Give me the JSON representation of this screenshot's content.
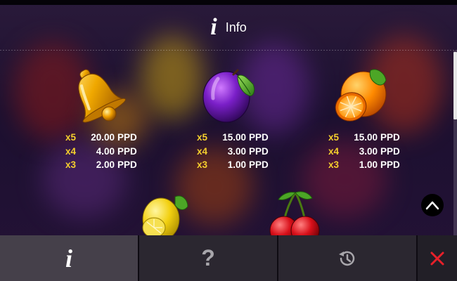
{
  "header": {
    "icon": "info-icon",
    "glyph": "i",
    "title": "Info"
  },
  "paytable": [
    {
      "symbol": "bell",
      "icon": "bell-icon",
      "pays": [
        {
          "mult": "x5",
          "value": "20.00",
          "currency": "PPD"
        },
        {
          "mult": "x4",
          "value": "4.00",
          "currency": "PPD"
        },
        {
          "mult": "x3",
          "value": "2.00",
          "currency": "PPD"
        }
      ]
    },
    {
      "symbol": "plum",
      "icon": "plum-icon",
      "pays": [
        {
          "mult": "x5",
          "value": "15.00",
          "currency": "PPD"
        },
        {
          "mult": "x4",
          "value": "3.00",
          "currency": "PPD"
        },
        {
          "mult": "x3",
          "value": "1.00",
          "currency": "PPD"
        }
      ]
    },
    {
      "symbol": "orange",
      "icon": "orange-icon",
      "pays": [
        {
          "mult": "x5",
          "value": "15.00",
          "currency": "PPD"
        },
        {
          "mult": "x4",
          "value": "3.00",
          "currency": "PPD"
        },
        {
          "mult": "x3",
          "value": "1.00",
          "currency": "PPD"
        }
      ]
    },
    {
      "symbol": "lemon",
      "icon": "lemon-icon",
      "pays": []
    },
    {
      "symbol": "cherry",
      "icon": "cherry-icon",
      "pays": []
    }
  ],
  "bottom_nav": {
    "info": {
      "icon": "info-icon",
      "glyph": "i"
    },
    "help": {
      "icon": "question-icon",
      "glyph": "?"
    },
    "history": {
      "icon": "history-icon"
    },
    "close": {
      "icon": "close-icon"
    }
  },
  "colors": {
    "multiplier": "#f5cf2d",
    "value": "#ffffff",
    "close": "#e8202a",
    "nav_active": "#45404a",
    "nav_inactive": "#2b2730"
  }
}
